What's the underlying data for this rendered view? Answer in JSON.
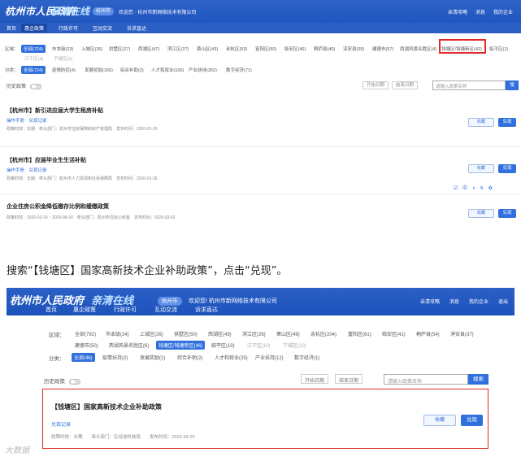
{
  "shot1": {
    "logo_main": "杭州市人民政府",
    "logo_sub": "亲清在线",
    "city": "杭州市",
    "welcome": "欢迎您 · 杭州市新网络技术有限公司",
    "top_links": [
      "亲清攻略",
      "消息",
      "我的企业"
    ],
    "nav": [
      "首页",
      "惠企政策",
      "行政许可",
      "互动交流",
      "诉求直达"
    ],
    "area_label": "区域：",
    "areas_row1": [
      "全部(724)",
      "市本级(23)",
      "上城区(26)",
      "拱墅区(27)",
      "西湖区(47)",
      "滨江区(27)",
      "萧山区(43)",
      "余杭区(53)",
      "富阳区(50)",
      "临安区(46)",
      "桐庐县(40)",
      "淳安县(35)",
      "建德市(57)",
      "西湖风景名胜区(4)",
      "钱塘区/钱塘新区(42)",
      "临平区(1)"
    ],
    "areas_row2": [
      "江干区(3)",
      "下城区(1)"
    ],
    "cat_label": "分类：",
    "categories": [
      "全部(724)",
      "疫情防控(4)",
      "发展奖励(165)",
      "综合补助(2)",
      "人才和就业(106)",
      "产业扶持(302)",
      "数字经济(71)"
    ],
    "history_label": "历史政策",
    "start_date": "开始日期",
    "end_date": "结束日期",
    "search_placeholder": "请输入政策名称",
    "search_button": "搜",
    "policies": [
      {
        "title": "【杭州市】新引进应届大学生租房补贴",
        "actions": "操作手册　兑现记录",
        "meta": "政策时效：长期　牵头部门：杭州市住房保障和房产管理局　发布时间：2020-01-26",
        "fav": "收藏",
        "redeem": "兑现"
      },
      {
        "title": "【杭州市】应届毕业生生活补贴",
        "actions": "操作手册　兑现记录",
        "meta": "政策时效：长期　牵头部门：杭州市人力资源和社会保障局　发布时间：2020-01-26",
        "fav": "收藏",
        "redeem": "兑现"
      },
      {
        "title": "企业住房公积金降低缴存比例和缓缴政策",
        "actions": "",
        "meta": "政策时效：2020-02-10 ~ 2020-06-30　牵头部门：杭州市住房公积金　发布时间：2020-03-02",
        "fav": "收藏",
        "redeem": "兑现"
      }
    ],
    "mini_tools": "☑ 中 ◑ ↯ ✿"
  },
  "instruction": "搜索“【钱塘区】国家高新技术企业补助政策”，点击“兑现”。",
  "shot2": {
    "logo_main": "杭州市人民政府",
    "logo_sub": "亲清在线",
    "city": "杭州市",
    "welcome": "欢迎您! 杭州市新网络技术有限公司",
    "top_links": [
      "亲清攻略",
      "消息",
      "我的企业",
      "退出"
    ],
    "nav": [
      "首页",
      "惠企政策",
      "行政许可",
      "互动交流",
      "诉求直达"
    ],
    "area_label": "区域：",
    "areas_row1": [
      "全部(792)",
      "市本级(24)",
      "上城区(26)",
      "拱墅区(50)",
      "西湖区(49)",
      "滨江区(26)",
      "萧山区(49)",
      "余杭区(204)",
      "富阳区(61)",
      "临安区(41)",
      "桐庐县(54)",
      "淳安县(37)"
    ],
    "areas_row2": [
      "建德市(50)",
      "西湖风景名胜区(6)",
      "钱塘区/钱塘新区(46)",
      "临平区(10)",
      "江干区(10)",
      "下城区(10)"
    ],
    "cat_label": "分类：",
    "categories": [
      "全部(46)",
      "疫情扶持(2)",
      "发展奖励(2)",
      "综合补助(2)",
      "人才和就业(25)",
      "产业扶持(12)",
      "数字经济(1)"
    ],
    "history_label": "历史政策",
    "start_date": "开始日期",
    "end_date": "结束日期",
    "search_placeholder": "请输入政策名称",
    "search_button": "搜索",
    "result": {
      "title": "【钱塘区】国家高新技术企业补助政策",
      "action": "兑现记录",
      "meta": "政策时效：长期　　牵头部门：区经信科技局　　发布时间：2022-04-26",
      "fav": "收藏",
      "redeem": "兑现"
    }
  },
  "watermark": "大数据"
}
